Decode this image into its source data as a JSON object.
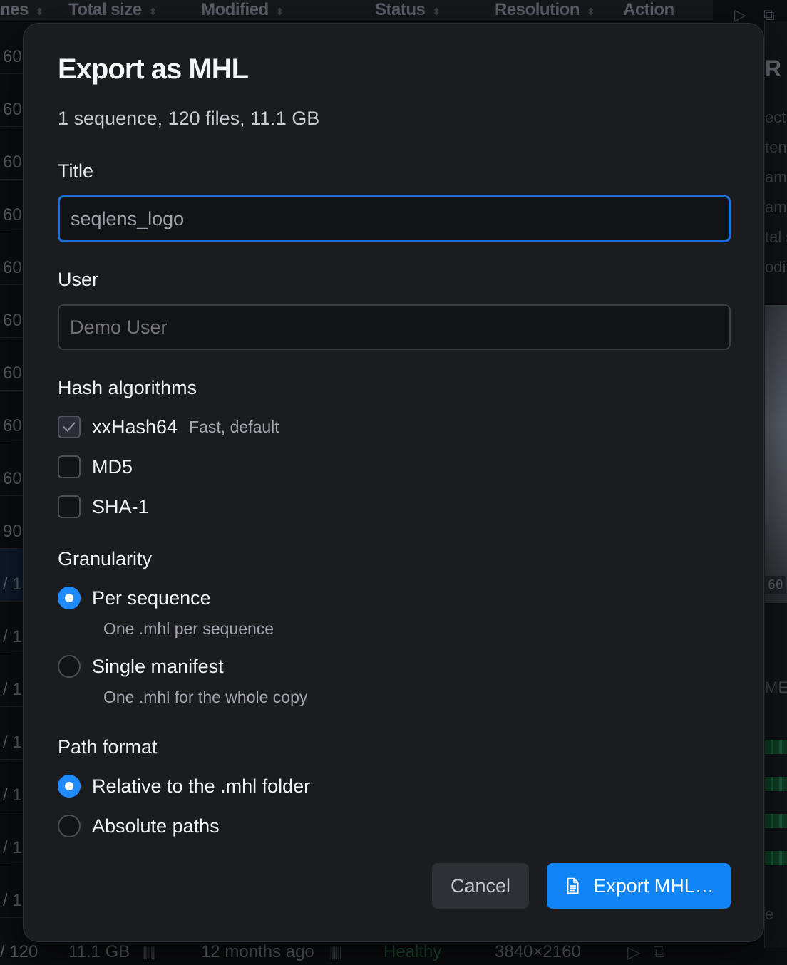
{
  "background": {
    "columns": [
      "nes",
      "Total size",
      "Modified",
      "Status",
      "Resolution",
      "Action"
    ],
    "row_values": [
      "60",
      "60",
      "60",
      "60",
      "60",
      "60",
      "60",
      "60",
      "60",
      "90",
      "/ 1",
      "/ 1",
      "/ 1",
      "/ 1",
      "/ 1",
      "/ 1",
      "/ 1"
    ],
    "right_panel": {
      "title": "R",
      "fields": [
        "ect",
        "ten",
        "ame",
        "ame",
        "tal s",
        "odif"
      ],
      "preview_tag": "60",
      "section": "MES",
      "footer": "e"
    },
    "bottom_row": {
      "count": "/ 120",
      "size": "11.1 GB",
      "modified": "12 months ago",
      "status": "Healthy",
      "resolution": "3840×2160"
    }
  },
  "dialog": {
    "title": "Export as MHL",
    "summary": "1 sequence, 120 files, 11.1 GB",
    "title_field": {
      "label": "Title",
      "value": "seqlens_logo"
    },
    "user_field": {
      "label": "User",
      "placeholder": "Demo User"
    },
    "hash": {
      "label": "Hash algorithms",
      "options": [
        {
          "label": "xxHash64",
          "hint": "Fast, default",
          "checked": true
        },
        {
          "label": "MD5",
          "checked": false
        },
        {
          "label": "SHA-1",
          "checked": false
        }
      ]
    },
    "granularity": {
      "label": "Granularity",
      "options": [
        {
          "label": "Per sequence",
          "hint": "One .mhl per sequence",
          "selected": true
        },
        {
          "label": "Single manifest",
          "hint": "One .mhl for the whole copy",
          "selected": false
        }
      ]
    },
    "path_format": {
      "label": "Path format",
      "options": [
        {
          "label": "Relative to the .mhl folder",
          "selected": true
        },
        {
          "label": "Absolute paths",
          "selected": false
        }
      ]
    },
    "buttons": {
      "cancel": "Cancel",
      "export": "Export MHL…"
    },
    "colors": {
      "accent": "#0e84f5",
      "focus_border": "#1c6fdc",
      "surface": "#1a1c20"
    }
  }
}
